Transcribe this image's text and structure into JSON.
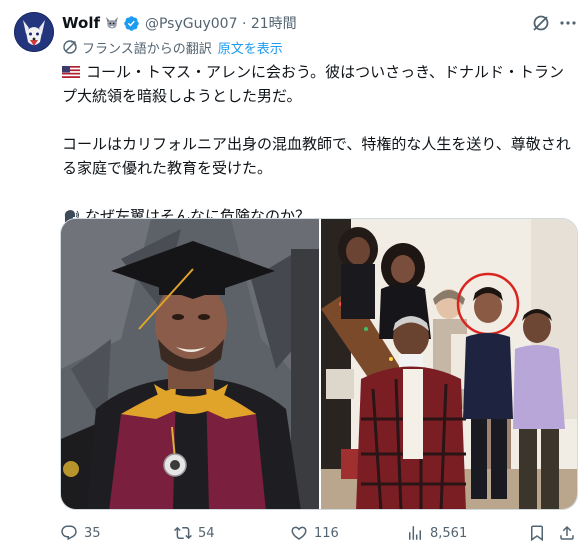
{
  "author": {
    "name": "Wolf",
    "handle_time": "@PsyGuy007 · 21時間",
    "name_emoji": "wolf-icon",
    "verified_icon": "verified-badge-icon"
  },
  "translation": {
    "label": "フランス語からの翻訳",
    "show_original": "原文を表示"
  },
  "body": {
    "line1": "コール・トマス・アレンに会おう。彼はついさっき、ドナルド・トランプ大統領を暗殺しようとした男だ。",
    "line2": "コールはカリフォルニア出身の混血教師で、特権的な人生を送り、尊敬される家庭で優れた教育を受けた。",
    "line3": "なぜ左翼はそんなに危険なのか？"
  },
  "media": {
    "left": "graduation-portrait-photo",
    "right": "family-group-photo"
  },
  "actions": {
    "replies": "35",
    "reposts": "54",
    "likes": "116",
    "views": "8,561"
  },
  "colors": {
    "accent": "#1d9bf0",
    "muted": "#536471",
    "text": "#0f1419",
    "border": "#cfd9de"
  }
}
